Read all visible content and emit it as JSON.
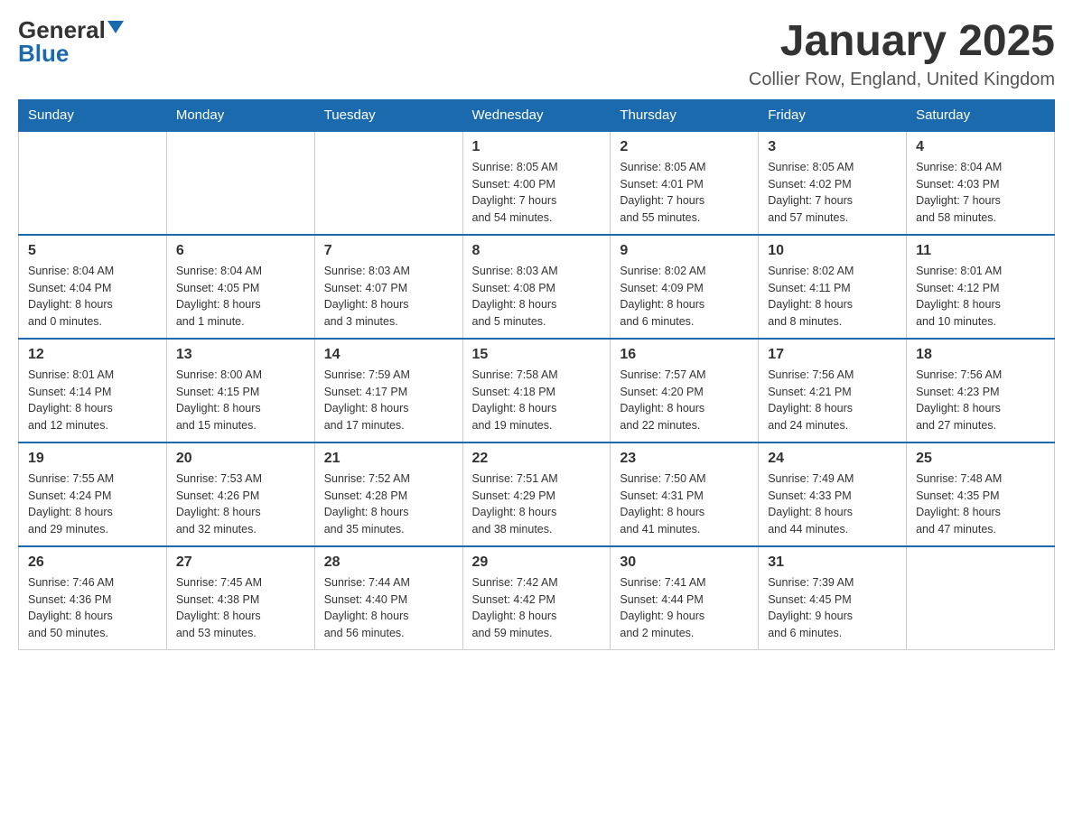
{
  "header": {
    "logo_general": "General",
    "logo_blue": "Blue",
    "month_title": "January 2025",
    "location": "Collier Row, England, United Kingdom"
  },
  "days_of_week": [
    "Sunday",
    "Monday",
    "Tuesday",
    "Wednesday",
    "Thursday",
    "Friday",
    "Saturday"
  ],
  "weeks": [
    [
      {
        "day": "",
        "info": ""
      },
      {
        "day": "",
        "info": ""
      },
      {
        "day": "",
        "info": ""
      },
      {
        "day": "1",
        "info": "Sunrise: 8:05 AM\nSunset: 4:00 PM\nDaylight: 7 hours\nand 54 minutes."
      },
      {
        "day": "2",
        "info": "Sunrise: 8:05 AM\nSunset: 4:01 PM\nDaylight: 7 hours\nand 55 minutes."
      },
      {
        "day": "3",
        "info": "Sunrise: 8:05 AM\nSunset: 4:02 PM\nDaylight: 7 hours\nand 57 minutes."
      },
      {
        "day": "4",
        "info": "Sunrise: 8:04 AM\nSunset: 4:03 PM\nDaylight: 7 hours\nand 58 minutes."
      }
    ],
    [
      {
        "day": "5",
        "info": "Sunrise: 8:04 AM\nSunset: 4:04 PM\nDaylight: 8 hours\nand 0 minutes."
      },
      {
        "day": "6",
        "info": "Sunrise: 8:04 AM\nSunset: 4:05 PM\nDaylight: 8 hours\nand 1 minute."
      },
      {
        "day": "7",
        "info": "Sunrise: 8:03 AM\nSunset: 4:07 PM\nDaylight: 8 hours\nand 3 minutes."
      },
      {
        "day": "8",
        "info": "Sunrise: 8:03 AM\nSunset: 4:08 PM\nDaylight: 8 hours\nand 5 minutes."
      },
      {
        "day": "9",
        "info": "Sunrise: 8:02 AM\nSunset: 4:09 PM\nDaylight: 8 hours\nand 6 minutes."
      },
      {
        "day": "10",
        "info": "Sunrise: 8:02 AM\nSunset: 4:11 PM\nDaylight: 8 hours\nand 8 minutes."
      },
      {
        "day": "11",
        "info": "Sunrise: 8:01 AM\nSunset: 4:12 PM\nDaylight: 8 hours\nand 10 minutes."
      }
    ],
    [
      {
        "day": "12",
        "info": "Sunrise: 8:01 AM\nSunset: 4:14 PM\nDaylight: 8 hours\nand 12 minutes."
      },
      {
        "day": "13",
        "info": "Sunrise: 8:00 AM\nSunset: 4:15 PM\nDaylight: 8 hours\nand 15 minutes."
      },
      {
        "day": "14",
        "info": "Sunrise: 7:59 AM\nSunset: 4:17 PM\nDaylight: 8 hours\nand 17 minutes."
      },
      {
        "day": "15",
        "info": "Sunrise: 7:58 AM\nSunset: 4:18 PM\nDaylight: 8 hours\nand 19 minutes."
      },
      {
        "day": "16",
        "info": "Sunrise: 7:57 AM\nSunset: 4:20 PM\nDaylight: 8 hours\nand 22 minutes."
      },
      {
        "day": "17",
        "info": "Sunrise: 7:56 AM\nSunset: 4:21 PM\nDaylight: 8 hours\nand 24 minutes."
      },
      {
        "day": "18",
        "info": "Sunrise: 7:56 AM\nSunset: 4:23 PM\nDaylight: 8 hours\nand 27 minutes."
      }
    ],
    [
      {
        "day": "19",
        "info": "Sunrise: 7:55 AM\nSunset: 4:24 PM\nDaylight: 8 hours\nand 29 minutes."
      },
      {
        "day": "20",
        "info": "Sunrise: 7:53 AM\nSunset: 4:26 PM\nDaylight: 8 hours\nand 32 minutes."
      },
      {
        "day": "21",
        "info": "Sunrise: 7:52 AM\nSunset: 4:28 PM\nDaylight: 8 hours\nand 35 minutes."
      },
      {
        "day": "22",
        "info": "Sunrise: 7:51 AM\nSunset: 4:29 PM\nDaylight: 8 hours\nand 38 minutes."
      },
      {
        "day": "23",
        "info": "Sunrise: 7:50 AM\nSunset: 4:31 PM\nDaylight: 8 hours\nand 41 minutes."
      },
      {
        "day": "24",
        "info": "Sunrise: 7:49 AM\nSunset: 4:33 PM\nDaylight: 8 hours\nand 44 minutes."
      },
      {
        "day": "25",
        "info": "Sunrise: 7:48 AM\nSunset: 4:35 PM\nDaylight: 8 hours\nand 47 minutes."
      }
    ],
    [
      {
        "day": "26",
        "info": "Sunrise: 7:46 AM\nSunset: 4:36 PM\nDaylight: 8 hours\nand 50 minutes."
      },
      {
        "day": "27",
        "info": "Sunrise: 7:45 AM\nSunset: 4:38 PM\nDaylight: 8 hours\nand 53 minutes."
      },
      {
        "day": "28",
        "info": "Sunrise: 7:44 AM\nSunset: 4:40 PM\nDaylight: 8 hours\nand 56 minutes."
      },
      {
        "day": "29",
        "info": "Sunrise: 7:42 AM\nSunset: 4:42 PM\nDaylight: 8 hours\nand 59 minutes."
      },
      {
        "day": "30",
        "info": "Sunrise: 7:41 AM\nSunset: 4:44 PM\nDaylight: 9 hours\nand 2 minutes."
      },
      {
        "day": "31",
        "info": "Sunrise: 7:39 AM\nSunset: 4:45 PM\nDaylight: 9 hours\nand 6 minutes."
      },
      {
        "day": "",
        "info": ""
      }
    ]
  ]
}
